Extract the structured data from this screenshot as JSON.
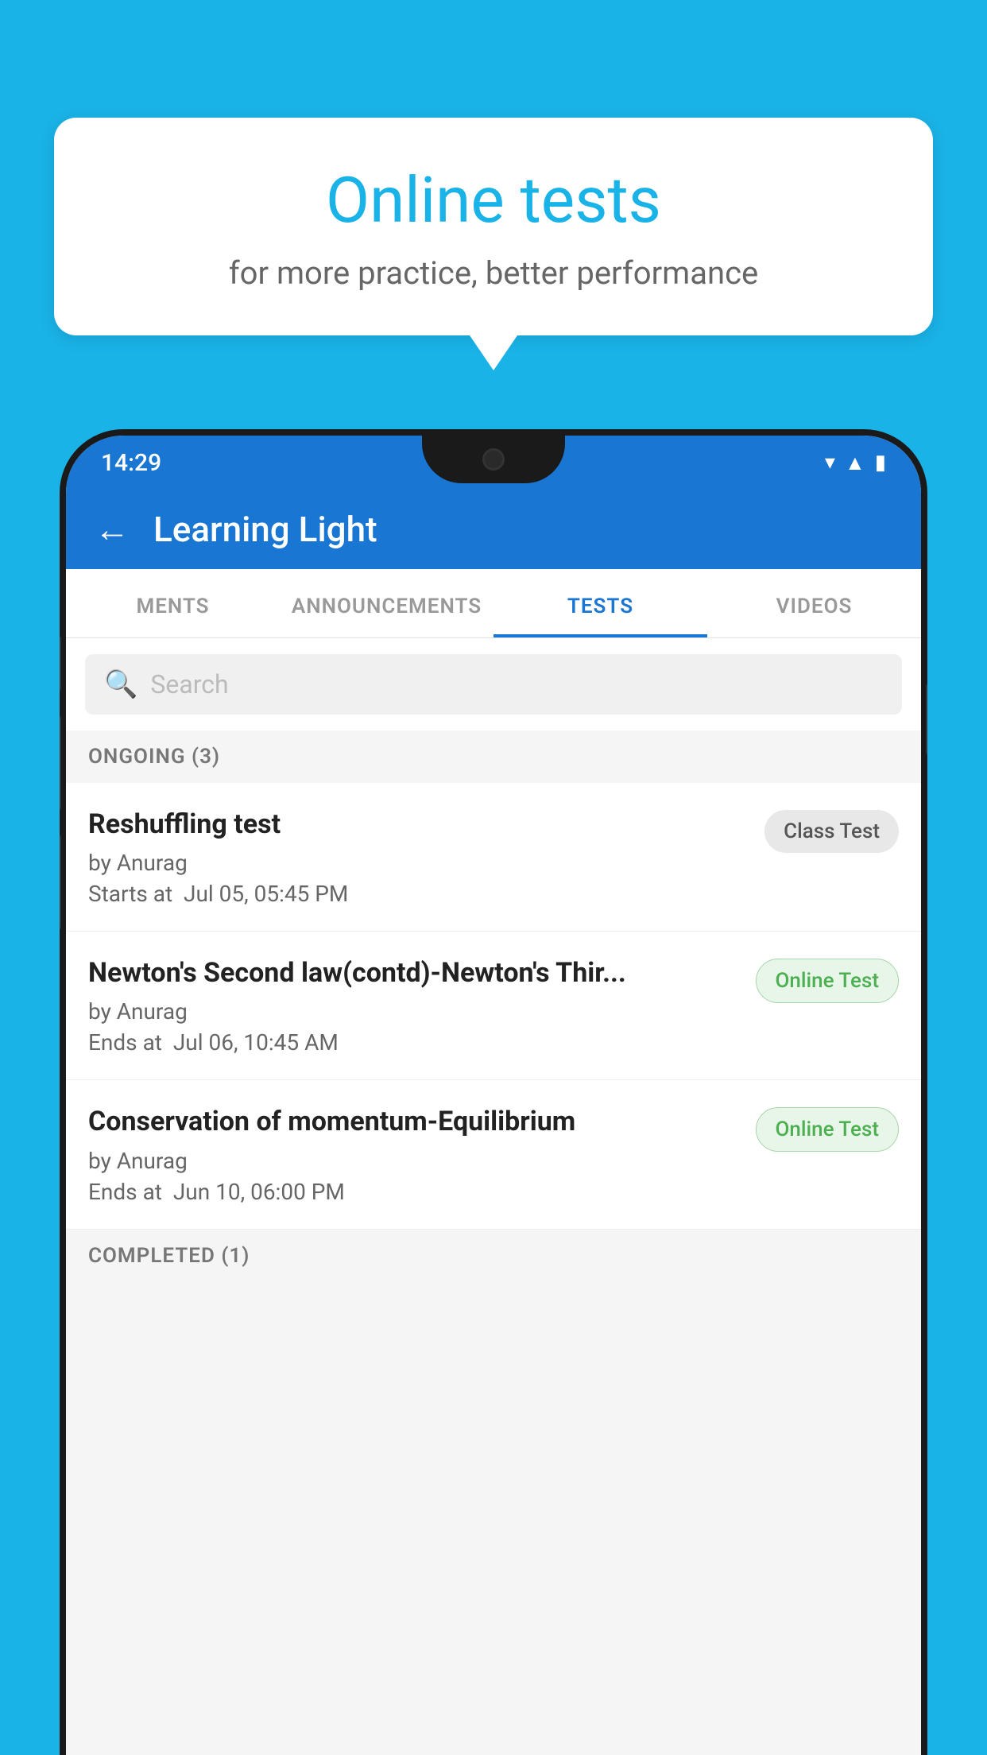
{
  "background": {
    "color": "#1ab3e8"
  },
  "bubble": {
    "title": "Online tests",
    "subtitle": "for more practice, better performance"
  },
  "status_bar": {
    "time": "14:29",
    "icons": [
      "▼",
      "▲",
      "▮"
    ]
  },
  "app_header": {
    "title": "Learning Light",
    "back_label": "←"
  },
  "tabs": [
    {
      "label": "MENTS",
      "active": false
    },
    {
      "label": "ANNOUNCEMENTS",
      "active": false
    },
    {
      "label": "TESTS",
      "active": true
    },
    {
      "label": "VIDEOS",
      "active": false
    }
  ],
  "search": {
    "placeholder": "Search"
  },
  "ongoing_section": {
    "label": "ONGOING (3)"
  },
  "tests": [
    {
      "name": "Reshuffling test",
      "author": "by Anurag",
      "time_label": "Starts at",
      "time_value": "Jul 05, 05:45 PM",
      "badge": "Class Test",
      "badge_type": "class"
    },
    {
      "name": "Newton's Second law(contd)-Newton's Thir...",
      "author": "by Anurag",
      "time_label": "Ends at",
      "time_value": "Jul 06, 10:45 AM",
      "badge": "Online Test",
      "badge_type": "online"
    },
    {
      "name": "Conservation of momentum-Equilibrium",
      "author": "by Anurag",
      "time_label": "Ends at",
      "time_value": "Jun 10, 06:00 PM",
      "badge": "Online Test",
      "badge_type": "online"
    }
  ],
  "completed_section": {
    "label": "COMPLETED (1)"
  }
}
